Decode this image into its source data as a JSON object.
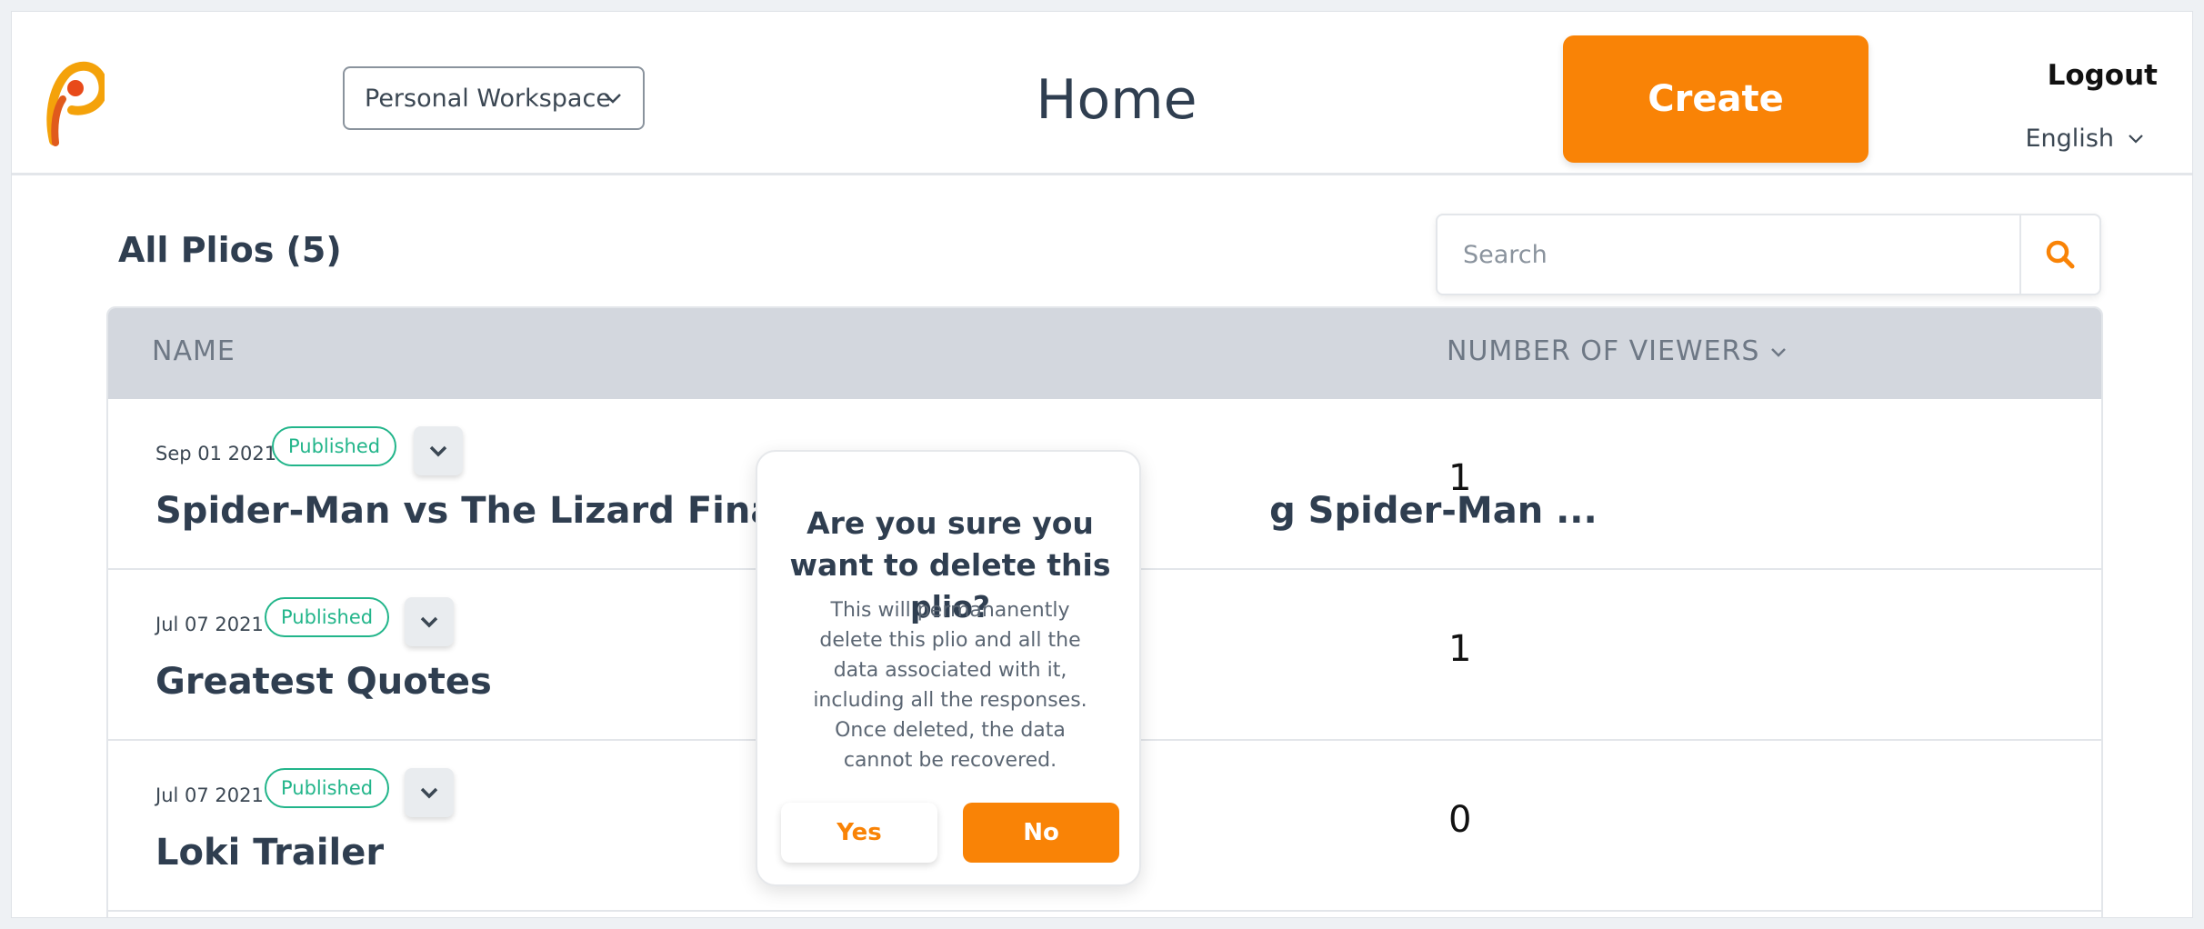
{
  "header": {
    "workspace": "Personal Workspace",
    "title": "Home",
    "create_label": "Create",
    "logout_label": "Logout",
    "language": "English"
  },
  "colors": {
    "accent": "#f98306",
    "published": "#22b58a",
    "table_header": "#d3d7de"
  },
  "list": {
    "heading": "All Plios (5)",
    "search_placeholder": "Search",
    "columns": {
      "name": "NAME",
      "viewers": "NUMBER OF VIEWERS"
    },
    "rows": [
      {
        "date": "Sep 01 2021",
        "status": "Published",
        "title": "Spider-Man vs The Lizard Final Figh",
        "title_tail": "g Spider-Man ...",
        "viewers": "1"
      },
      {
        "date": "Jul 07 2021",
        "status": "Published",
        "title": "Greatest Quotes",
        "viewers": "1"
      },
      {
        "date": "Jul 07 2021",
        "status": "Published",
        "title": "Loki Trailer",
        "viewers": "0"
      }
    ]
  },
  "dialog": {
    "title": "Are you sure you want to delete this plio?",
    "message": "This will permananently delete this plio and all the data associated with it, including all the responses. Once deleted, the data cannot be recovered.",
    "yes_label": "Yes",
    "no_label": "No"
  },
  "icons": {
    "logo": "plio-logo-icon",
    "search": "search-icon",
    "chevron": "chevron-down-icon"
  }
}
